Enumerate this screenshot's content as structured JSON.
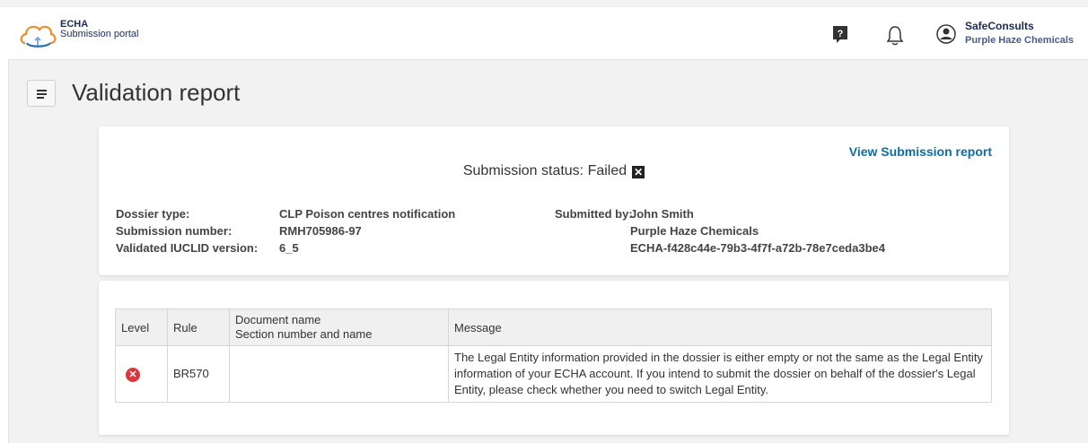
{
  "header": {
    "logo_line1": "ECHA",
    "logo_line2": "Submission portal",
    "user_name": "SafeConsults",
    "user_org": "Purple Haze Chemicals",
    "help_icon": "?"
  },
  "page": {
    "title": "Validation report"
  },
  "summary": {
    "view_link": "View Submission report",
    "status_label": "Submission status:",
    "status_value": "Failed",
    "dossier_type_label": "Dossier type:",
    "dossier_type_value": "CLP Poison centres notification",
    "submission_number_label": "Submission number:",
    "submission_number_value": "RMH705986-97",
    "iuclid_label": "Validated IUCLID version:",
    "iuclid_value": "6_5",
    "submitted_by_label": "Submitted by:",
    "submitted_by_name": "John Smith",
    "submitted_by_org": "Purple Haze Chemicals",
    "submitted_by_id": "ECHA-f428c44e-79b3-4f7f-a72b-78e7ceda3be4"
  },
  "table": {
    "headers": {
      "level": "Level",
      "rule": "Rule",
      "doc_line1": "Document name",
      "doc_line2": "Section number and name",
      "message": "Message"
    },
    "rows": [
      {
        "level_icon": "error-icon",
        "rule": "BR570",
        "document": "",
        "message": "The Legal Entity information provided in the dossier is either empty or not the same as the Legal Entity information of your ECHA account. If you intend to submit the dossier on behalf of the dossier's Legal Entity, please check whether you need to switch Legal Entity."
      }
    ]
  },
  "colors": {
    "brand": "#1a2b5a",
    "link": "#0b6ea6",
    "error": "#d9363e"
  }
}
